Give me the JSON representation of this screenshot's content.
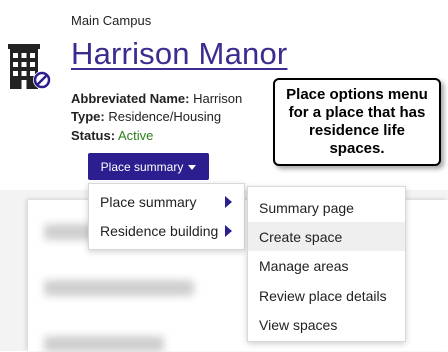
{
  "header": {
    "campus": "Main Campus",
    "title": "Harrison Manor",
    "icon": "building-no-icon"
  },
  "details": {
    "abbrev_label": "Abbreviated Name:",
    "abbrev_value": "Harrison",
    "type_label": "Type:",
    "type_value": "Residence/Housing",
    "status_label": "Status:",
    "status_value": "Active",
    "status_color": "#2e7d1e"
  },
  "place_button": {
    "label": "Place summary",
    "color": "#2b1f8f"
  },
  "menu": {
    "items": [
      {
        "label": "Place summary"
      },
      {
        "label": "Residence building"
      }
    ]
  },
  "submenu": {
    "items": [
      {
        "label": "Summary page"
      },
      {
        "label": "Create space"
      },
      {
        "label": "Manage areas"
      },
      {
        "label": "Review place details"
      },
      {
        "label": "View spaces"
      }
    ]
  },
  "callout": {
    "text": "Place options menu for a place that has residence life spaces."
  }
}
